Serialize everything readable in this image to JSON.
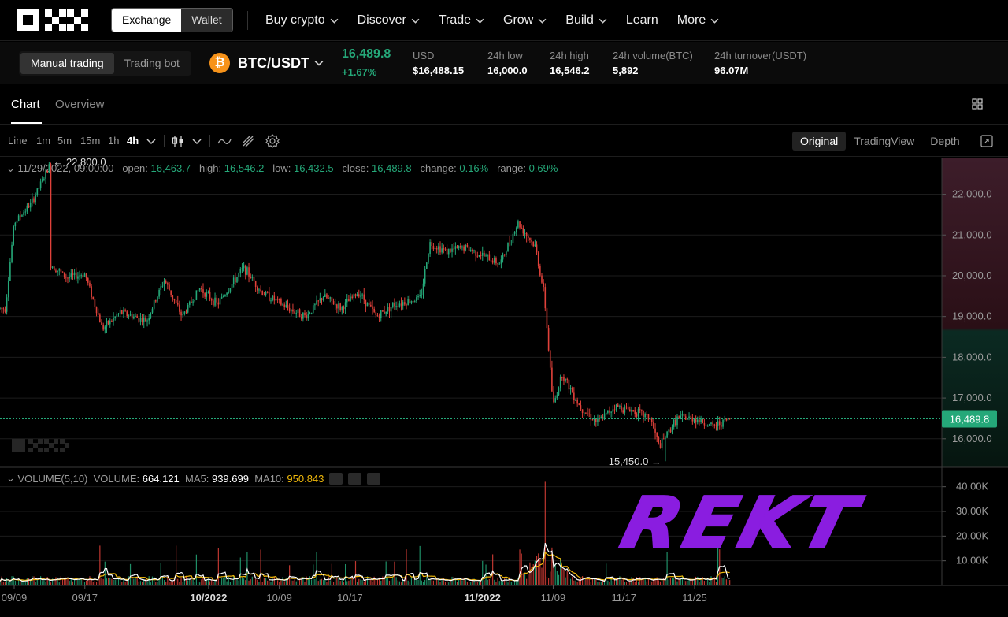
{
  "nav": {
    "exchange_label": "Exchange",
    "wallet_label": "Wallet",
    "items": [
      "Buy crypto",
      "Discover",
      "Trade",
      "Grow",
      "Build",
      "Learn",
      "More"
    ]
  },
  "ticker": {
    "manual_label": "Manual trading",
    "bot_label": "Trading bot",
    "coin_symbol": "₿",
    "pair": "BTC/USDT",
    "price": "16,489.8",
    "change": "+1.67%",
    "stats": [
      {
        "key": "USD",
        "value": "$16,488.15"
      },
      {
        "key": "24h low",
        "value": "16,000.0"
      },
      {
        "key": "24h high",
        "value": "16,546.2"
      },
      {
        "key": "24h volume(BTC)",
        "value": "5,892"
      },
      {
        "key": "24h turnover(USDT)",
        "value": "96.07M"
      }
    ]
  },
  "tabs": {
    "chart": "Chart",
    "overview": "Overview"
  },
  "toolbar": {
    "line": "Line",
    "timeframes": [
      "1m",
      "5m",
      "15m",
      "1h",
      "4h"
    ],
    "active_timeframe": "4h",
    "views": [
      "Original",
      "TradingView",
      "Depth"
    ],
    "active_view": "Original"
  },
  "ohlc": {
    "datetime": "11/29/2022, 09:00:00",
    "open_label": "open:",
    "open": "16,463.7",
    "high_label": "high:",
    "high": "16,546.2",
    "low_label": "low:",
    "low": "16,432.5",
    "close_label": "close:",
    "close": "16,489.8",
    "change_label": "change:",
    "change": "0.16%",
    "range_label": "range:",
    "range": "0.69%"
  },
  "volume": {
    "title": "VOLUME(5,10)",
    "volume_label": "VOLUME:",
    "volume": "664.121",
    "ma5_label": "MA5:",
    "ma5": "939.699",
    "ma10_label": "MA10:",
    "ma10": "950.843"
  },
  "watermark": "REKT",
  "colors": {
    "up": "#25a879",
    "down": "#e0413a",
    "accent": "#8a1de0",
    "ma10": "#f0b90b"
  },
  "chart_data": {
    "type": "candlestick",
    "pair": "BTC/USDT",
    "interval": "4h",
    "x_ticks": [
      "09/09",
      "09/17",
      "10/2022",
      "10/09",
      "10/17",
      "11/2022",
      "11/09",
      "11/17",
      "11/25"
    ],
    "y_ticks": [
      "16,000.0",
      "17,000.0",
      "18,000.0",
      "19,000.0",
      "20,000.0",
      "21,000.0",
      "22,000.0"
    ],
    "ylim": [
      15300,
      22900
    ],
    "high_marker": "22,800.0",
    "low_marker": "15,450.0",
    "current_price": "16,489.8",
    "price_path": [
      {
        "x": "09/08",
        "y": 19200
      },
      {
        "x": "09/09",
        "y": 21300
      },
      {
        "x": "09/11",
        "y": 21800
      },
      {
        "x": "09/13",
        "y": 22700
      },
      {
        "x": "09/13",
        "y": 20300
      },
      {
        "x": "09/15",
        "y": 19950
      },
      {
        "x": "09/17",
        "y": 20050
      },
      {
        "x": "09/19",
        "y": 18700
      },
      {
        "x": "09/21",
        "y": 19100
      },
      {
        "x": "09/24",
        "y": 18900
      },
      {
        "x": "09/26",
        "y": 19900
      },
      {
        "x": "09/28",
        "y": 19000
      },
      {
        "x": "09/30",
        "y": 19700
      },
      {
        "x": "10/02",
        "y": 19300
      },
      {
        "x": "10/05",
        "y": 20200
      },
      {
        "x": "10/07",
        "y": 19600
      },
      {
        "x": "10/10",
        "y": 19200
      },
      {
        "x": "10/12",
        "y": 19000
      },
      {
        "x": "10/14",
        "y": 19500
      },
      {
        "x": "10/16",
        "y": 19200
      },
      {
        "x": "10/18",
        "y": 19600
      },
      {
        "x": "10/20",
        "y": 19000
      },
      {
        "x": "10/22",
        "y": 19300
      },
      {
        "x": "10/25",
        "y": 19450
      },
      {
        "x": "10/26",
        "y": 20800
      },
      {
        "x": "10/28",
        "y": 20600
      },
      {
        "x": "10/30",
        "y": 20700
      },
      {
        "x": "11/01",
        "y": 20500
      },
      {
        "x": "11/03",
        "y": 20300
      },
      {
        "x": "11/05",
        "y": 21300
      },
      {
        "x": "11/07",
        "y": 20700
      },
      {
        "x": "11/08",
        "y": 19500
      },
      {
        "x": "11/09",
        "y": 16800
      },
      {
        "x": "11/10",
        "y": 17600
      },
      {
        "x": "11/12",
        "y": 16800
      },
      {
        "x": "11/14",
        "y": 16400
      },
      {
        "x": "11/16",
        "y": 16800
      },
      {
        "x": "11/18",
        "y": 16700
      },
      {
        "x": "11/20",
        "y": 16500
      },
      {
        "x": "11/21",
        "y": 15800
      },
      {
        "x": "11/23",
        "y": 16500
      },
      {
        "x": "11/25",
        "y": 16500
      },
      {
        "x": "11/27",
        "y": 16300
      },
      {
        "x": "11/29",
        "y": 16490
      }
    ],
    "volume_ticks": [
      "10.00K",
      "20.00K",
      "30.00K",
      "40.00K"
    ],
    "volume_ylim": [
      0,
      45000
    ]
  }
}
